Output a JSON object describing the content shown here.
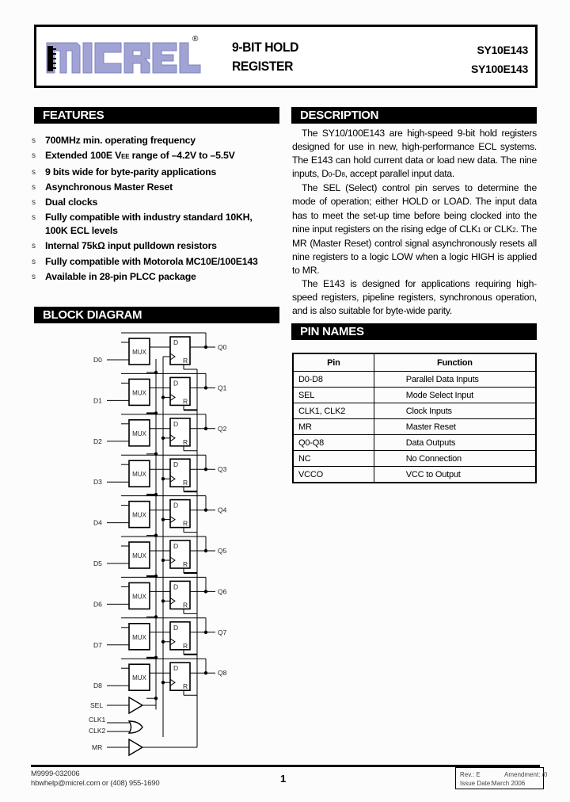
{
  "header": {
    "logo_text": "MICREL",
    "logo_mark": "®",
    "title_line1": "9-BIT HOLD",
    "title_line2": "REGISTER",
    "part_number_1": "SY10E143",
    "part_number_2": "SY100E143",
    "logo_color": "#9b9fd0"
  },
  "features": {
    "heading": "FEATURES",
    "bullet": "s",
    "items": [
      "700MHz min. operating frequency",
      "Extended 100E VEE range of –4.2V to –5.5V",
      "9 bits wide for byte-parity applications",
      "Asynchronous Master Reset",
      "Dual clocks",
      "Fully compatible with industry standard 10KH, 100K ECL levels",
      "Internal 75kΩ input pulldown resistors",
      "Fully compatible with Motorola MC10E/100E143",
      "Available in 28-pin PLCC package"
    ],
    "item1_parts": {
      "a": "Extended 100E V",
      "sub": "EE",
      "b": " range of –4.2V to –5.5V"
    },
    "item5_parts": {
      "a": "Fully compatible with industry standard 10KH,",
      "b": "100K ECL levels"
    }
  },
  "description": {
    "heading": "DESCRIPTION",
    "p1": {
      "a": "The SY10/100E143  are high-speed 9-bit hold registers designed for use in new, high-performance ECL systems. The E143 can hold current data or load new data.  The nine inputs, D",
      "s1": "0",
      "b": "-D",
      "s2": "8",
      "c": ", accept parallel input data."
    },
    "p2": {
      "a": "The SEL (Select) control pin serves to determine the mode of operation; either HOLD or LOAD.  The input data has to meet the set-up time before being clocked into the nine input registers on the rising edge of CLK",
      "s1": "1",
      "b": " or CLK",
      "s2": "2",
      "c": ". The MR (Master Reset) control signal asynchronously resets all nine registers to a logic LOW when a logic HIGH is applied to MR."
    },
    "p3": "The E143 is designed for applications requiring high-speed registers, pipeline registers, synchronous operation, and is also suitable for byte-wide parity."
  },
  "block_diagram": {
    "heading": "BLOCK DIAGRAM",
    "mux_label": "MUX",
    "ff_d_label": "D",
    "ff_r_label": "R",
    "inputs": [
      "D0",
      "D1",
      "D2",
      "D3",
      "D4",
      "D5",
      "D6",
      "D7",
      "D8"
    ],
    "outputs": [
      "Q0",
      "Q1",
      "Q2",
      "Q3",
      "Q4",
      "Q5",
      "Q6",
      "Q7",
      "Q8"
    ],
    "control_labels": {
      "sel": "SEL",
      "clk1": "CLK1",
      "clk2": "CLK2",
      "mr": "MR"
    }
  },
  "pin_names": {
    "heading": "PIN NAMES",
    "columns": [
      "Pin",
      "Function"
    ],
    "rows": [
      {
        "pin": "D0-D8",
        "function": "Parallel Data Inputs"
      },
      {
        "pin": "SEL",
        "function": "Mode Select Input"
      },
      {
        "pin": "CLK1, CLK2",
        "function": "Clock Inputs"
      },
      {
        "pin": "MR",
        "function": "Master Reset"
      },
      {
        "pin": "Q0-Q8",
        "function": "Data Outputs"
      },
      {
        "pin": "NC",
        "function": "No Connection"
      },
      {
        "pin": "VCCO",
        "function": "VCC to Output"
      }
    ]
  },
  "footer": {
    "doc_number": "M9999-032006",
    "contact": "hbwhelp@micrel.com or (408) 955-1690",
    "page_number": "1",
    "rev_label": "Rev.:",
    "rev_value": "E",
    "amendment_label": "Amendment:",
    "amendment_value": "/0",
    "issue_label": "Issue Date:",
    "issue_value": "March 2006"
  }
}
